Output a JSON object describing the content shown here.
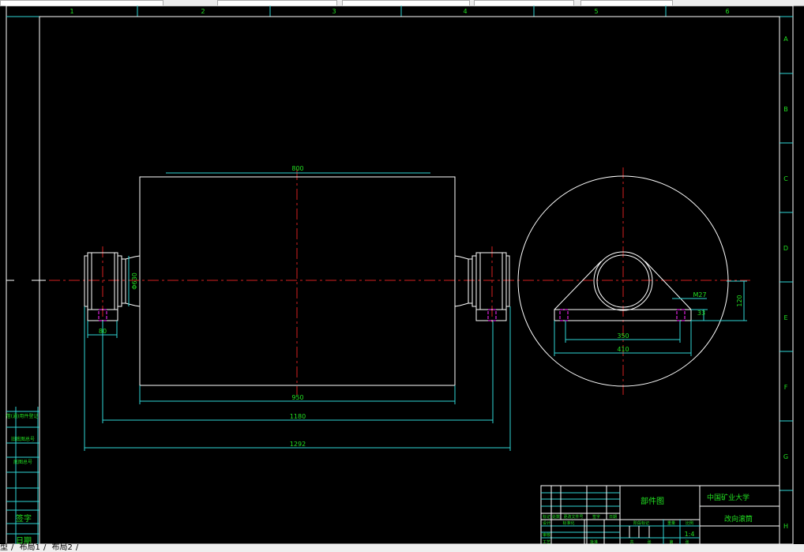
{
  "layout_tabs": [
    "型",
    "布局1",
    "布局2"
  ],
  "zones": {
    "columns": [
      "1",
      "2",
      "3",
      "4",
      "5",
      "6"
    ],
    "rows": [
      "A",
      "B",
      "C",
      "D",
      "E",
      "F",
      "G",
      "H"
    ]
  },
  "dimensions": {
    "drum_length": "800",
    "drum_diameter": "Φ630",
    "length_950": "950",
    "length_1180": "1180",
    "length_1292": "1292",
    "bearing_width": "80",
    "bolt_spacing": "350",
    "base_length": "410",
    "bolt_size": "M27",
    "base_thickness": "33",
    "center_height": "120"
  },
  "title_block": {
    "drawing_type": "部件图",
    "school": "中国矿业大学",
    "part_name": "改向滚筒",
    "scale": "1:4",
    "cells": [
      "标记",
      "处数",
      "更改文件号",
      "签字",
      "日期",
      "设计",
      "标准化",
      "阶段标记",
      "重量",
      "比例",
      "审核",
      "工艺",
      "批准",
      "共",
      "张",
      "第",
      "张"
    ]
  },
  "left_strip": [
    "借(通)用件登记",
    "旧底图总号",
    "底图总号",
    "签字",
    "日期"
  ],
  "colors": {
    "background": "#000000",
    "outline": "#ffffff",
    "dimension": "#2fd6d6",
    "centerline": "#d42020",
    "text": "#22e022",
    "hidden": "#e020e0"
  }
}
